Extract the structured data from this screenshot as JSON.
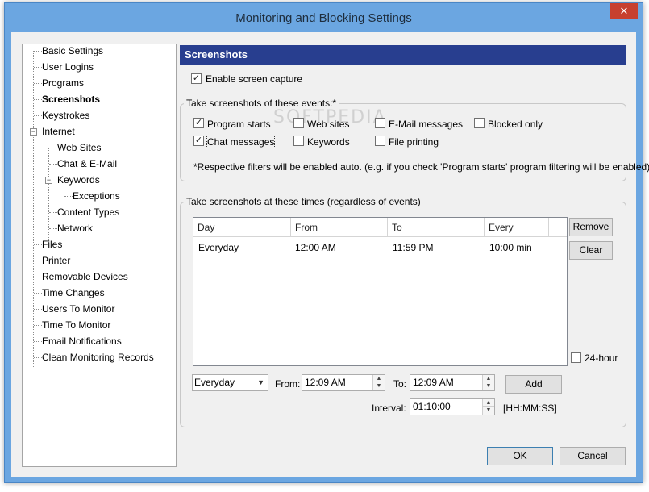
{
  "window": {
    "title": "Monitoring and Blocking Settings",
    "close_glyph": "✕"
  },
  "tree": {
    "items": [
      {
        "label": "Basic Settings"
      },
      {
        "label": "User Logins"
      },
      {
        "label": "Programs"
      },
      {
        "label": "Screenshots",
        "selected": true
      },
      {
        "label": "Keystrokes"
      },
      {
        "label": "Internet",
        "expanded": true
      },
      {
        "label": "Web Sites"
      },
      {
        "label": "Chat & E-Mail"
      },
      {
        "label": "Keywords",
        "expanded": true
      },
      {
        "label": "Exceptions"
      },
      {
        "label": "Content Types"
      },
      {
        "label": "Network"
      },
      {
        "label": "Files"
      },
      {
        "label": "Printer"
      },
      {
        "label": "Removable Devices"
      },
      {
        "label": "Time Changes"
      },
      {
        "label": "Users To Monitor"
      },
      {
        "label": "Time To Monitor"
      },
      {
        "label": "Email Notifications"
      },
      {
        "label": "Clean Monitoring Records"
      }
    ],
    "expander_minus": "−"
  },
  "panel": {
    "header": "Screenshots",
    "enable_capture": {
      "label": "Enable screen capture",
      "checked": true
    },
    "events_group": {
      "title": "Take screenshots of these events:*",
      "checkboxes": [
        {
          "label": "Program starts",
          "checked": true
        },
        {
          "label": "Web sites",
          "checked": false
        },
        {
          "label": "E-Mail messages",
          "checked": false
        },
        {
          "label": "Blocked only",
          "checked": false
        },
        {
          "label": "Chat messages",
          "checked": true
        },
        {
          "label": "Keywords",
          "checked": false
        },
        {
          "label": "File printing",
          "checked": false
        }
      ],
      "note": "*Respective filters will be enabled auto. (e.g. if you check 'Program starts' program filtering will be enabled)"
    },
    "times_group": {
      "title": "Take screenshots at these times (regardless of events)",
      "columns": [
        "Day",
        "From",
        "To",
        "Every"
      ],
      "rows": [
        {
          "day": "Everyday",
          "from": "12:00 AM",
          "to": "11:59 PM",
          "every": "10:00 min"
        }
      ],
      "remove_label": "Remove",
      "clear_label": "Clear",
      "hour24": {
        "label": "24-hour",
        "checked": false
      },
      "day_select": "Everyday",
      "from_label": "From:",
      "from_value": "12:09 AM",
      "to_label": "To:",
      "to_value": "12:09 AM",
      "add_label": "Add",
      "interval_label": "Interval:",
      "interval_value": "01:10:00",
      "interval_format": "[HH:MM:SS]"
    },
    "ok_label": "OK",
    "cancel_label": "Cancel"
  },
  "checkmark": "✓",
  "watermark": "SOFTPEDIA"
}
